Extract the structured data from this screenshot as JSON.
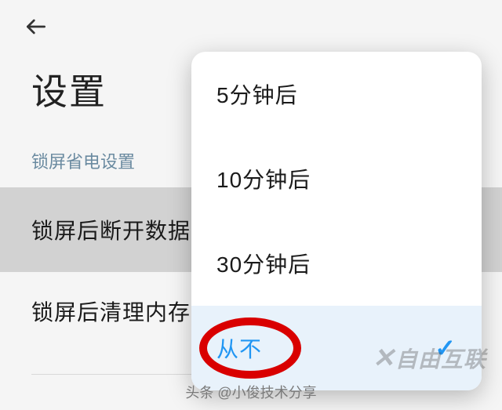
{
  "header": {
    "back_icon": "back-arrow"
  },
  "page_title": "设置",
  "section_label": "锁屏省电设置",
  "rows": {
    "disconnect_data": "锁屏后断开数据",
    "clear_memory": "锁屏后清理内存"
  },
  "dropdown": {
    "options": [
      "5分钟后",
      "10分钟后",
      "30分钟后",
      "从不"
    ],
    "selected_index": 3
  },
  "annotation": {
    "circle_target": "从不"
  },
  "watermark": "自由互联",
  "footer": {
    "prefix": "头条",
    "author": "@小俊技术分享"
  }
}
